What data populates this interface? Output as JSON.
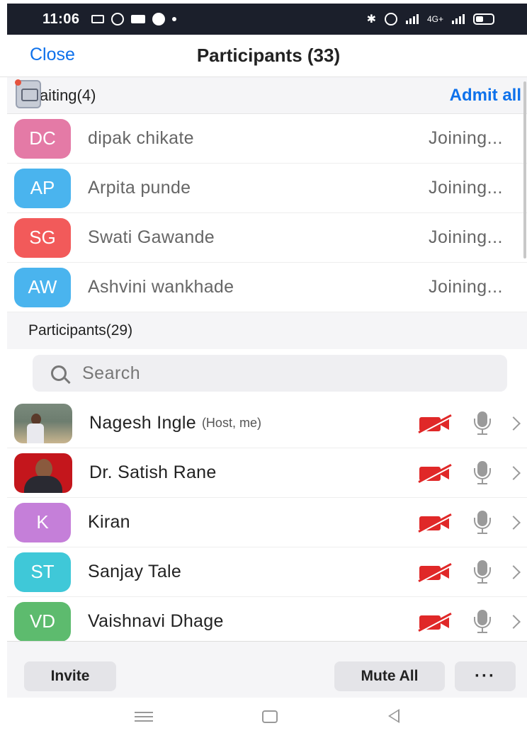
{
  "status_bar": {
    "time": "11:06",
    "network_label": "4G+"
  },
  "header": {
    "close_label": "Close",
    "title": "Participants (33)"
  },
  "waiting": {
    "label": "Waiting(4)",
    "admit_all_label": "Admit all",
    "items": [
      {
        "initials": "DC",
        "name": "dipak chikate",
        "status": "Joining...",
        "color": "#e47aa6"
      },
      {
        "initials": "AP",
        "name": "Arpita punde",
        "status": "Joining...",
        "color": "#4ab4ee"
      },
      {
        "initials": "SG",
        "name": "Swati Gawande",
        "status": "Joining...",
        "color": "#f25a5a"
      },
      {
        "initials": "AW",
        "name": "Ashvini wankhade",
        "status": "Joining...",
        "color": "#4ab4ee"
      }
    ]
  },
  "participants": {
    "label": "Participants(29)",
    "search_placeholder": "Search",
    "items": [
      {
        "initials": "",
        "name": "Nagesh Ingle",
        "role": "(Host, me)",
        "has_photo": true
      },
      {
        "initials": "",
        "name": "Dr. Satish Rane",
        "role": "",
        "has_photo": true
      },
      {
        "initials": "K",
        "name": "Kiran",
        "role": "",
        "color": "#c57fd9"
      },
      {
        "initials": "ST",
        "name": "Sanjay Tale",
        "role": "",
        "color": "#3fc8d8"
      },
      {
        "initials": "VD",
        "name": "Vaishnavi Dhage",
        "role": "",
        "color": "#5dbb6e"
      }
    ]
  },
  "footer": {
    "invite_label": "Invite",
    "mute_all_label": "Mute All",
    "more_label": "···"
  },
  "colors": {
    "accent": "#0e71eb",
    "video_off": "#e02828"
  }
}
